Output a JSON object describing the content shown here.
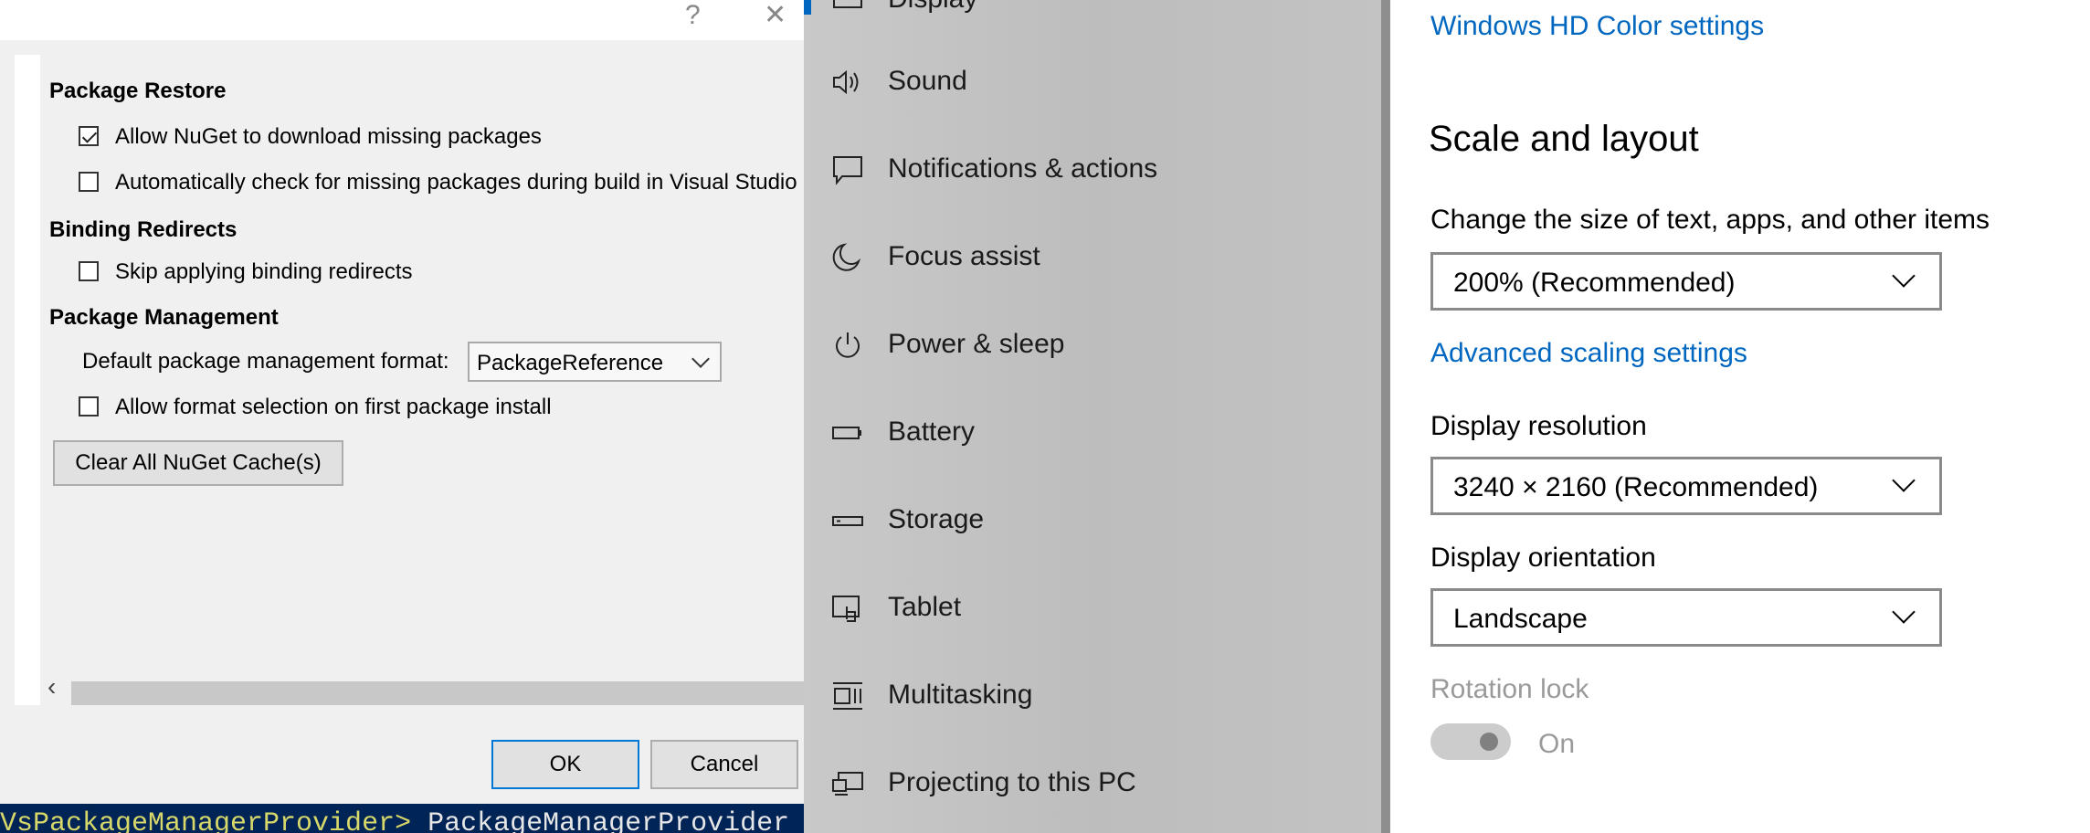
{
  "dialog": {
    "help_glyph": "?",
    "close_glyph": "✕",
    "sections": {
      "restore": "Package Restore",
      "binding": "Binding Redirects",
      "management": "Package Management"
    },
    "options": {
      "allow_download": {
        "label": "Allow NuGet to download missing packages",
        "checked": true
      },
      "auto_check": {
        "label": "Automatically check for missing packages during build in Visual Studio",
        "checked": false
      },
      "skip_binding": {
        "label": "Skip applying binding redirects",
        "checked": false
      },
      "allow_format": {
        "label": "Allow format selection on first package install",
        "checked": false
      }
    },
    "format_label": "Default package management format:",
    "format_value": "PackageReference",
    "clear_button": "Clear All NuGet Cache(s)",
    "scroll_left_glyph": "‹",
    "ok_button": "OK",
    "cancel_button": "Cancel"
  },
  "console": {
    "prompt": "VsPackageManagerProvider>",
    "text": " PackageManagerProvider"
  },
  "nav": {
    "items": [
      {
        "label": "Display",
        "icon": "display-icon"
      },
      {
        "label": "Sound",
        "icon": "sound-icon"
      },
      {
        "label": "Notifications & actions",
        "icon": "notifications-icon"
      },
      {
        "label": "Focus assist",
        "icon": "moon-icon"
      },
      {
        "label": "Power & sleep",
        "icon": "power-icon"
      },
      {
        "label": "Battery",
        "icon": "battery-icon"
      },
      {
        "label": "Storage",
        "icon": "storage-icon"
      },
      {
        "label": "Tablet",
        "icon": "tablet-icon"
      },
      {
        "label": "Multitasking",
        "icon": "multitasking-icon"
      },
      {
        "label": "Projecting to this PC",
        "icon": "projecting-icon"
      }
    ],
    "accent_color": "#0067c0"
  },
  "content": {
    "hd_color_link": "Windows HD Color settings",
    "scale_heading": "Scale and layout",
    "scale_label": "Change the size of text, apps, and other items",
    "scale_value": "200% (Recommended)",
    "advanced_link": "Advanced scaling settings",
    "resolution_label": "Display resolution",
    "resolution_value": "3240 × 2160 (Recommended)",
    "orientation_label": "Display orientation",
    "orientation_value": "Landscape",
    "rotation_label": "Rotation lock",
    "rotation_state": "On",
    "link_color": "#0067c0"
  }
}
